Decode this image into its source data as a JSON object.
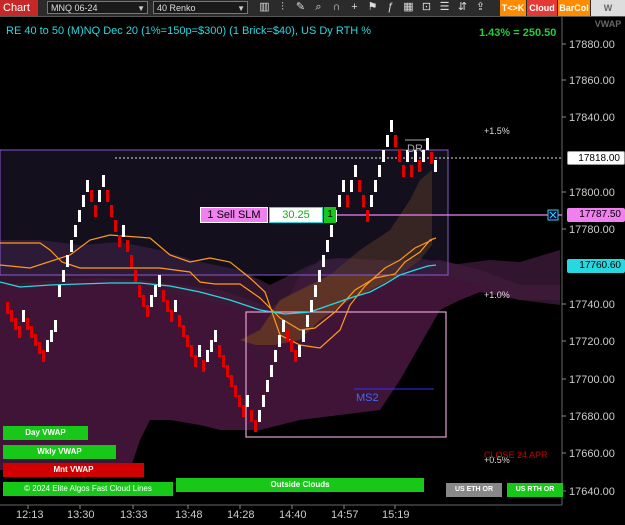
{
  "toolbar": {
    "chart_tab": "Chart",
    "instrument": "MNQ 06-24",
    "bar_type": "40 Renko",
    "icons": [
      "bars-icon",
      "chart-style-icon",
      "pencil-icon",
      "zoom-icon",
      "magnet-icon",
      "crosshair-icon",
      "strategy-icon",
      "indicator-icon",
      "template-icon",
      "lock-icon",
      "list-icon",
      "sort-icon",
      "share-icon",
      "properties-icon",
      "ruler-icon",
      "alert-icon"
    ],
    "tag_tk": "T<>K",
    "tag_cloud": "Cloud",
    "tag_barcol": "BarCol",
    "tag_vwap": "W VWAP"
  },
  "chart": {
    "title": "RE 40 to 50 (M)NQ Dec 20 (1%=150p=$300) (1 Brick=$40), US Dy RTH %",
    "pct_label": "1.43% = 250.50",
    "price_axis": [
      "17880.00",
      "17860.00",
      "17840.00",
      "17818.00",
      "17800.00",
      "17780.00",
      "17760.00",
      "17740.00",
      "17720.00",
      "17700.00",
      "17680.00",
      "17660.00",
      "17640.00"
    ],
    "time_axis": [
      "12:13",
      "13:30",
      "13:33",
      "13:48",
      "14:28",
      "14:40",
      "14:57",
      "15:19"
    ],
    "current_price": "17818.00",
    "order_price": "17787.50",
    "cloud_price": "17760.60",
    "pct_plus15": "+1.5%",
    "pct_plus10": "+1.0%",
    "pct_plus05": "+0.5%",
    "dr_label": "DR",
    "ms2_label": "MS2",
    "close_label": "CLOSE 24 APR",
    "order": {
      "label": "1 Sell SLM",
      "price": "30.25",
      "qty": "1"
    }
  },
  "buttons": {
    "day_vwap": "Day VWAP",
    "wkly_vwap": "Wkly VWAP",
    "mnt_vwap": "Mnt VWAP",
    "copyright": "© 2024 Elite Algos Fast Cloud Lines",
    "outside_clouds": "Outside Clouds",
    "us_eth_or": "US ETH OR",
    "us_rth_or": "US RTH OR"
  },
  "colors": {
    "accent_cyan": "#27d8e0",
    "up": "#ffffff",
    "down": "#e00000",
    "order_pink": "#f080f0",
    "green": "#18c818"
  }
}
